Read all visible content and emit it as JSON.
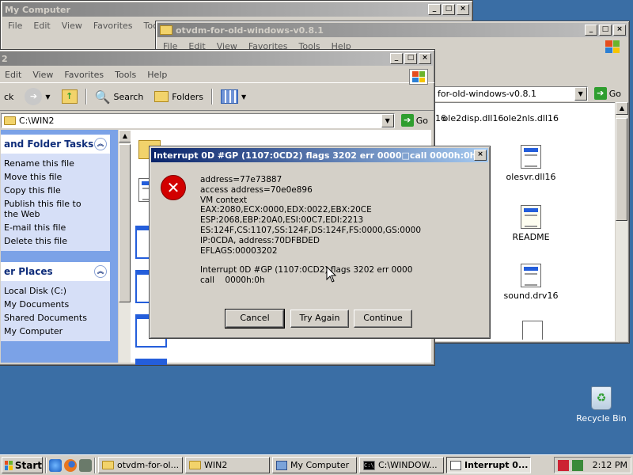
{
  "win_mycomputer": {
    "title": "My Computer",
    "menu": [
      "File",
      "Edit",
      "View",
      "Favorites",
      "Toc"
    ]
  },
  "win_otvdm": {
    "title": "otvdm-for-old-windows-v0.8.1",
    "menu": [
      "File",
      "Edit",
      "View",
      "Favorites",
      "Tools",
      "Help"
    ],
    "address": "for-old-windows-v0.8.1",
    "go_label": "Go",
    "files": [
      {
        "name": "ole2disp.dll16"
      },
      {
        "name": "ole2nls.dll16"
      },
      {
        "name": "olesvr.dll16"
      },
      {
        "name": "README"
      },
      {
        "name": "sound.drv16"
      }
    ],
    "partial_label": "16"
  },
  "win_win2": {
    "title": "2",
    "menu": [
      "Edit",
      "View",
      "Favorites",
      "Tools",
      "Help"
    ],
    "toolbar": {
      "back_label": "ck",
      "search_label": "Search",
      "folders_label": "Folders"
    },
    "address": "C:\\WIN2",
    "go_label": "Go",
    "tasks_header": "and Folder Tasks",
    "tasks": [
      "Rename this file",
      "Move this file",
      "Copy this file",
      "Publish this file to the Web",
      "E-mail this file",
      "Delete this file"
    ],
    "places_header": "er Places",
    "places": [
      "Local Disk (C:)",
      "My Documents",
      "Shared Documents",
      "My Computer"
    ]
  },
  "dialog": {
    "title": "Interrupt 0D #GP (1107:0CD2) flags 3202 err 0000□call    0000h:0h□",
    "lines": [
      "address=77e73887",
      "access address=70e0e896",
      "VM context",
      "EAX:2080,ECX:0000,EDX:0022,EBX:20CE",
      "ESP:2068,EBP:20A0,ESI:00C7,EDI:2213",
      "ES:124F,CS:1107,SS:124F,DS:124F,FS:0000,GS:0000",
      "IP:0CDA, address:70DFBDED",
      "EFLAGS:00003202"
    ],
    "lines2": [
      "Interrupt 0D #GP (1107:0CD2) flags 3202 err 0000",
      "call    0000h:0h"
    ],
    "buttons": {
      "cancel": "Cancel",
      "try_again": "Try Again",
      "continue": "Continue"
    }
  },
  "desktop": {
    "recycle_bin": "Recycle Bin"
  },
  "taskbar": {
    "start": "Start",
    "buttons": [
      "otvdm-for-ol...",
      "WIN2",
      "My Computer",
      "C:\\WINDOW...",
      "Interrupt 0..."
    ],
    "clock": "2:12 PM"
  }
}
